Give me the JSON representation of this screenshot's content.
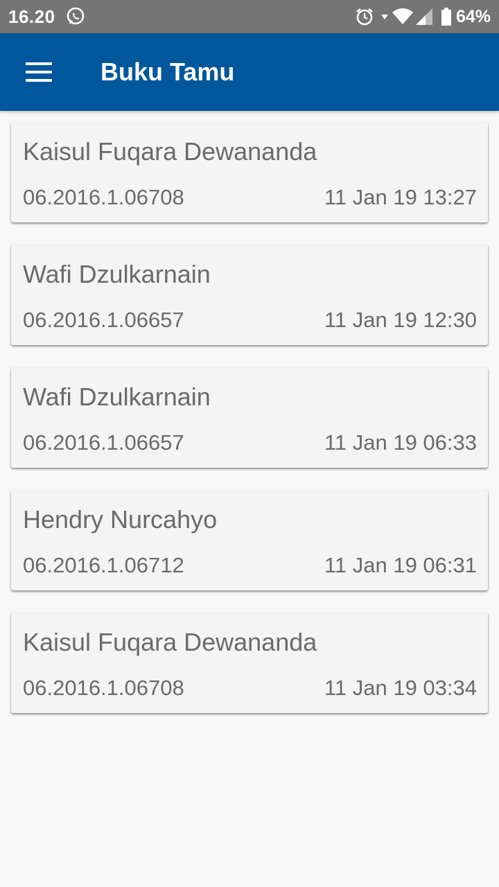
{
  "status_bar": {
    "time": "16.20",
    "battery": "64%",
    "icons": [
      "whatsapp-icon",
      "alarm-icon",
      "wifi-icon",
      "signal-icon",
      "battery-icon"
    ]
  },
  "app_bar": {
    "title": "Buku Tamu",
    "menu_icon": "menu-icon",
    "color": "#01579b"
  },
  "guests": [
    {
      "name": "Kaisul Fuqara Dewananda",
      "nim": "06.2016.1.06708",
      "time": "11 Jan 19 13:27"
    },
    {
      "name": "Wafi Dzulkarnain",
      "nim": "06.2016.1.06657",
      "time": "11 Jan 19 12:30"
    },
    {
      "name": "Wafi Dzulkarnain",
      "nim": "06.2016.1.06657",
      "time": "11 Jan 19 06:33"
    },
    {
      "name": "Hendry Nurcahyo",
      "nim": "06.2016.1.06712",
      "time": "11 Jan 19 06:31"
    },
    {
      "name": "Kaisul Fuqara Dewananda",
      "nim": "06.2016.1.06708",
      "time": "11 Jan 19 03:34"
    }
  ]
}
